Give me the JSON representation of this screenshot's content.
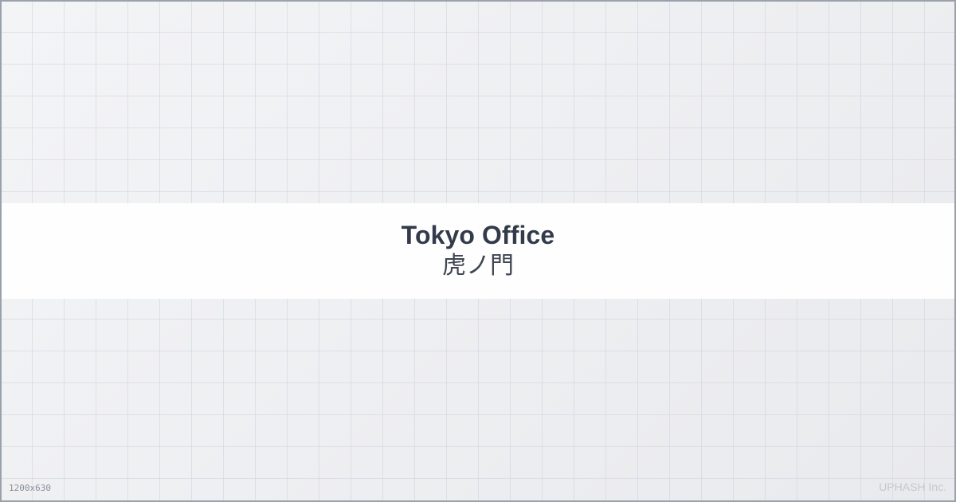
{
  "card": {
    "title": "Tokyo Office",
    "subtitle": "虎ノ門",
    "dimensions_label": "1200x630",
    "brand": "UPHASH Inc."
  },
  "colors": {
    "background": "#eef0f3",
    "grid_line": "#cdd2de",
    "band": "#ffffff",
    "title_text": "#333a4a",
    "subtitle_text": "#3f4553",
    "border": "#9ba1ab",
    "brand_text": "#c5c8ce",
    "dims_text": "#8a8f99"
  }
}
